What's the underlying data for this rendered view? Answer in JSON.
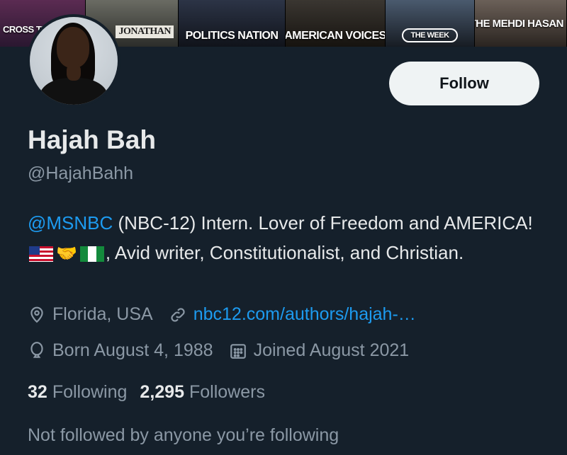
{
  "banner": {
    "tiles": [
      {
        "label": "CROSS TIEF"
      },
      {
        "label": "JONATHAN"
      },
      {
        "label": "POLITICS NATION"
      },
      {
        "label": "AMERICAN VOICES"
      },
      {
        "label": "THE WEEK"
      },
      {
        "label": "THE MEHDI HASAN"
      }
    ]
  },
  "profile": {
    "follow_label": "Follow",
    "display_name": "Hajah Bah",
    "handle": "@HajahBahh",
    "bio": {
      "mention": "@MSNBC",
      "text_1": " (NBC-12) Intern. Lover of Freedom and AMERICA! ",
      "text_2": ", Avid writer, Constitutionalist, and Christian."
    },
    "location": "Florida, USA",
    "website": "nbc12.com/authors/hajah-…",
    "birthday": "Born August 4, 1988",
    "joined": "Joined August 2021",
    "following_count": "32",
    "following_label": "Following",
    "followers_count": "2,295",
    "followers_label": "Followers",
    "not_followed_text": "Not followed by anyone you’re following"
  },
  "colors": {
    "background": "#15202b",
    "link": "#1d9bf0",
    "secondary_text": "#8b98a5"
  },
  "icons": {
    "location": "location-pin-icon",
    "link": "link-icon",
    "birthday": "balloon-icon",
    "joined": "calendar-icon"
  }
}
